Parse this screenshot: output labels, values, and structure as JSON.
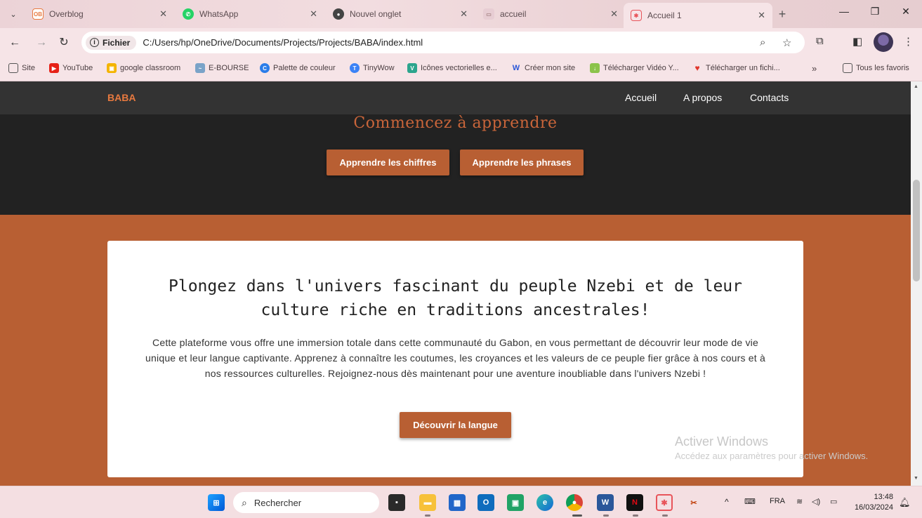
{
  "browser": {
    "tabs": [
      {
        "title": "Overblog",
        "favicon": "OB",
        "color": "#e8793f"
      },
      {
        "title": "WhatsApp",
        "favicon": "wa",
        "color": "#25d366"
      },
      {
        "title": "Nouvel onglet",
        "favicon": "g",
        "color": "#444444"
      },
      {
        "title": "accueil",
        "favicon": "ac",
        "color": "#c8a8b0"
      },
      {
        "title": "Accueil 1",
        "favicon": "a1",
        "color": "#e8545a"
      }
    ],
    "active_tab": "Accueil 1",
    "address": {
      "scheme_label": "Fichier",
      "url": "C:/Users/hp/OneDrive/Documents/Projects/Projects/BABA/index.html"
    },
    "bookmarks": [
      {
        "label": "Site",
        "icon": "folder-icon"
      },
      {
        "label": "YouTube",
        "icon": "youtube-icon"
      },
      {
        "label": "google classroom",
        "icon": "classroom-icon"
      },
      {
        "label": "E-BOURSE",
        "icon": "ebourse-icon"
      },
      {
        "label": "Palette de couleur",
        "icon": "palette-icon"
      },
      {
        "label": "TinyWow",
        "icon": "tinywow-icon"
      },
      {
        "label": "Icônes vectorielles e...",
        "icon": "vector-icon"
      },
      {
        "label": "Créer mon site",
        "icon": "wix-icon"
      },
      {
        "label": "Télécharger Vidéo Y...",
        "icon": "download-icon"
      },
      {
        "label": "Télécharger un fichi...",
        "icon": "heart-icon"
      }
    ],
    "bookmarks_more": "»",
    "all_bookmarks": "Tous les favoris"
  },
  "site": {
    "brand": "BABA",
    "nav": [
      "Accueil",
      "A propos",
      "Contacts"
    ],
    "hero": {
      "title": "Commencez à apprendre",
      "buttons": [
        "Apprendre les chiffres",
        "Apprendre les phrases"
      ]
    },
    "card": {
      "title": "Plongez dans l'univers fascinant du peuple Nzebi et de leur culture riche en traditions ancestrales!",
      "text": "Cette plateforme vous offre une immersion totale dans cette communauté du Gabon, en vous permettant de découvrir leur mode de vie unique et leur langue captivante. Apprenez à connaître les coutumes, les croyances et les valeurs de ce peuple fier grâce à nos cours et à nos ressources culturelles. Rejoignez-nous dès maintenant pour une aventure inoubliable dans l'univers Nzebi !",
      "button": "Découvrir la langue"
    },
    "colors": {
      "accent": "#b85f33",
      "brand": "#e8793f",
      "nav_bg": "#333333",
      "hero_bg": "#222222"
    }
  },
  "watermark": {
    "line1": "Activer Windows",
    "line2": "Accédez aux paramètres pour activer Windows."
  },
  "taskbar": {
    "search_placeholder": "Rechercher",
    "language": "FRA",
    "time": "13:48",
    "date": "16/03/2024"
  }
}
